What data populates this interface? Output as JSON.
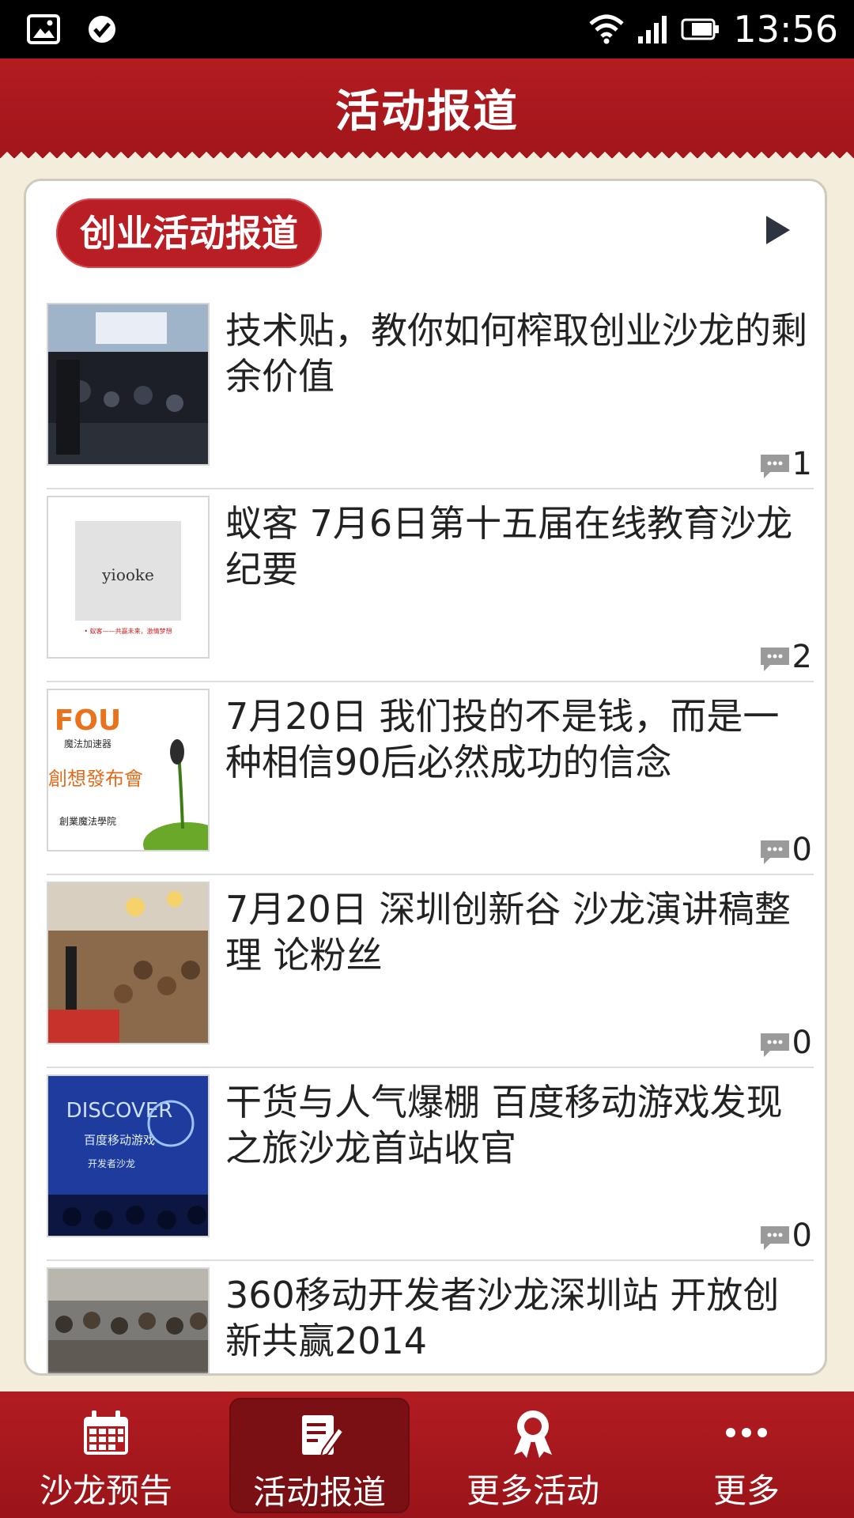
{
  "status_bar": {
    "time": "13:56",
    "icons": [
      "image-icon",
      "check-circle-icon",
      "wifi-icon",
      "signal-icon",
      "battery-icon"
    ]
  },
  "header": {
    "title": "活动报道"
  },
  "section": {
    "badge": "创业活动报道",
    "more_icon": "play-arrow-icon"
  },
  "articles": [
    {
      "title": "技术贴，教你如何榨取创业沙龙的剩余价值",
      "comments": "1",
      "thumb": "conference-hall-photo"
    },
    {
      "title": "蚁客 7月6日第十五届在线教育沙龙纪要",
      "comments": "2",
      "thumb": "yiooke-logo-slide"
    },
    {
      "title": "7月20日 我们投的不是钱，而是一种相信90后必然成功的信念",
      "comments": "0",
      "thumb": "launch-event-poster"
    },
    {
      "title": "7月20日 深圳创新谷 沙龙演讲稿整理 论粉丝",
      "comments": "0",
      "thumb": "salon-audience-photo"
    },
    {
      "title": "干货与人气爆棚 百度移动游戏发现之旅沙龙首站收官",
      "comments": "0",
      "thumb": "discover-stage-photo"
    },
    {
      "title": "360移动开发者沙龙深圳站 开放创新共赢2014",
      "comments": "",
      "thumb": "crowd-photo"
    }
  ],
  "thumb_texts": {
    "yiooke": "yiooke",
    "yiooke_caption": "• 蚁客——共赢未来，激情梦想",
    "fou": "FOU",
    "fou_sub": "魔法加速器",
    "fou_main": "創想發布會",
    "fou_school": "創業魔法學院",
    "discover": "DISCOVER",
    "discover_sub": "百度移动游戏",
    "discover_sub2": "开发者沙龙"
  },
  "tabs": [
    {
      "label": "沙龙预告",
      "icon": "calendar-icon",
      "active": false
    },
    {
      "label": "活动报道",
      "icon": "edit-note-icon",
      "active": true
    },
    {
      "label": "更多活动",
      "icon": "award-ribbon-icon",
      "active": false
    },
    {
      "label": "更多",
      "icon": "more-dots-icon",
      "active": false
    }
  ],
  "colors": {
    "brand_red": "#b21c21",
    "background": "#f3eedc",
    "active_tab": "#7a1014"
  }
}
